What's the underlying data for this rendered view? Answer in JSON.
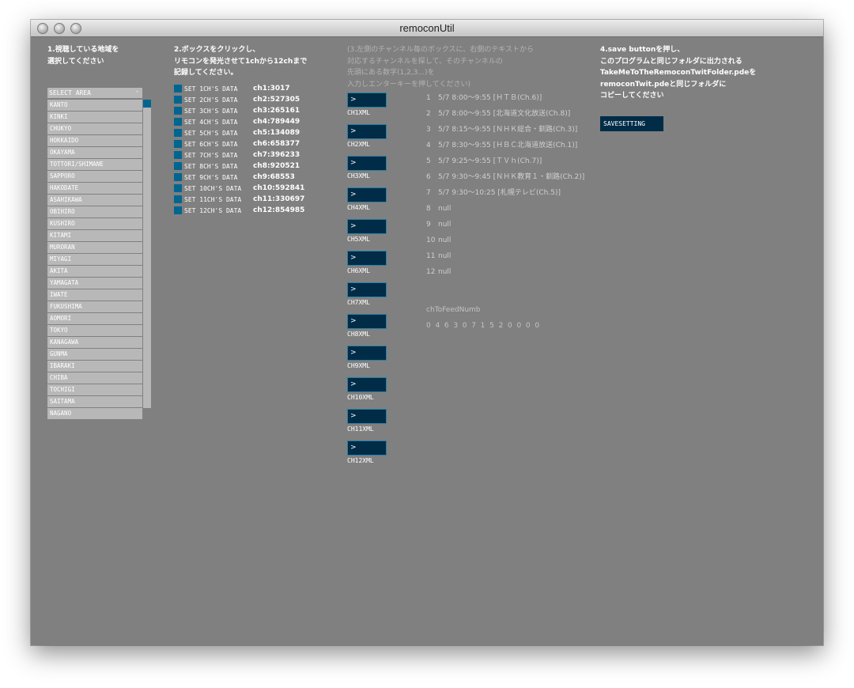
{
  "window": {
    "title": "remoconUtil"
  },
  "instructions": {
    "step1": "1.視聴している地域を\n選択してください",
    "step2": "2.ボックスをクリックし、\nリモコンを発光させて1chから12chまで\n記録してください。",
    "step3": "(3.左側のチャンネル毎のボックスに、右側のテキストから\n対応するチャンネルを探して、そのチャンネルの\n先頭にある数字(1,2,3...)を\n入力しエンターキーを押してください)",
    "step4": "4.save buttonを押し、\nこのプログラムと同じフォルダに出力される\nTakeMeToTheRemoconTwitFolder.pdeを\nremoconTwit.pdeと同じフォルダに\nコピーしてください"
  },
  "area_select": {
    "header": "SELECT AREA",
    "arrow": "-",
    "items": [
      "KANTO",
      "KINKI",
      "CHUKYO",
      "HOKKAIDO",
      "OKAYAMA",
      "TOTTORI/SHIMANE",
      "SAPPORO",
      "HAKODATE",
      "ASAHIKAWA",
      "OBIHIRO",
      "KUSHIRO",
      "KITAMI",
      "MURORAN",
      "MIYAGI",
      "AKITA",
      "YAMAGATA",
      "IWATE",
      "FUKUSHIMA",
      "AOMORI",
      "TOKYO",
      "KANAGAWA",
      "GUNMA",
      "IBARAKI",
      "CHIBA",
      "TOCHIGI",
      "SAITAMA",
      "NAGANO"
    ]
  },
  "set_data": [
    {
      "label": "SET 1CH'S DATA",
      "value": "ch1:3017"
    },
    {
      "label": "SET 2CH'S DATA",
      "value": "ch2:527305"
    },
    {
      "label": "SET 3CH'S DATA",
      "value": "ch3:265161"
    },
    {
      "label": "SET 4CH'S DATA",
      "value": "ch4:789449"
    },
    {
      "label": "SET 5CH'S DATA",
      "value": "ch5:134089"
    },
    {
      "label": "SET 6CH'S DATA",
      "value": "ch6:658377"
    },
    {
      "label": "SET 7CH'S DATA",
      "value": "ch7:396233"
    },
    {
      "label": "SET 8CH'S DATA",
      "value": "ch8:920521"
    },
    {
      "label": "SET 9CH'S DATA",
      "value": "ch9:68553"
    },
    {
      "label": "SET 10CH'S DATA",
      "value": "ch10:592841"
    },
    {
      "label": "SET 11CH'S DATA",
      "value": "ch11:330697"
    },
    {
      "label": "SET 12CH'S DATA",
      "value": "ch12:854985"
    }
  ],
  "ch_inputs": [
    {
      "value": ">",
      "label": "CH1XML"
    },
    {
      "value": ">",
      "label": "CH2XML"
    },
    {
      "value": ">",
      "label": "CH3XML"
    },
    {
      "value": ">",
      "label": "CH4XML"
    },
    {
      "value": ">",
      "label": "CH5XML"
    },
    {
      "value": ">",
      "label": "CH6XML"
    },
    {
      "value": ">",
      "label": "CH7XML"
    },
    {
      "value": ">",
      "label": "CH8XML"
    },
    {
      "value": ">",
      "label": "CH9XML"
    },
    {
      "value": ">",
      "label": "CH10XML"
    },
    {
      "value": ">",
      "label": "CH11XML"
    },
    {
      "value": ">",
      "label": "CH12XML"
    }
  ],
  "programs": [
    {
      "num": "1",
      "text": "5/7 8:00～9:55 [ＨＴＢ(Ch.6)]"
    },
    {
      "num": "2",
      "text": "5/7 8:00～9:55 [北海道文化放送(Ch.8)]"
    },
    {
      "num": "3",
      "text": "5/7 8:15～9:55 [ＮＨＫ総合・釧路(Ch.3)]"
    },
    {
      "num": "4",
      "text": "5/7 8:30～9:55 [ＨＢＣ北海道放送(Ch.1)]"
    },
    {
      "num": "5",
      "text": "5/7 9:25～9:55 [ＴＶｈ(Ch.7)]"
    },
    {
      "num": "6",
      "text": "5/7 9:30～9:45 [ＮＨＫ教育１・釧路(Ch.2)]"
    },
    {
      "num": "7",
      "text": "5/7 9:30～10:25 [札幌テレビ(Ch.5)]"
    },
    {
      "num": "8",
      "text": "null"
    },
    {
      "num": "9",
      "text": "null"
    },
    {
      "num": "10",
      "text": "null"
    },
    {
      "num": "11",
      "text": "null"
    },
    {
      "num": "12",
      "text": "null"
    }
  ],
  "feed": {
    "label": "chToFeedNumb",
    "values": "0  4  6  3  0  7  1  5  2  0  0  0  0"
  },
  "save_button": {
    "label": "SAVESETTING"
  }
}
